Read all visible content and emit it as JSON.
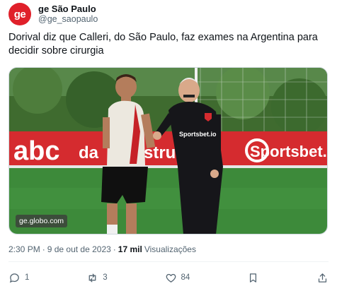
{
  "author": {
    "display_name": "ge São Paulo",
    "handle": "@ge_saopaulo",
    "avatar_text": "ge"
  },
  "tweet": {
    "text": "Dorival diz que Calleri, do São Paulo, faz exames na Argentina para decidir sobre cirurgia"
  },
  "media": {
    "banner_left": "abc",
    "banner_mid": "da",
    "banner_mid2": "strua",
    "banner_right": "Sportsbet.io",
    "shirt_text": "Sportsbet.io",
    "watermark": "ge.globo.com"
  },
  "meta": {
    "time": "2:30 PM",
    "sep1": "·",
    "date": "9 de out de 2023",
    "sep2": "·",
    "views_count": "17 mil",
    "views_label": "Visualizações"
  },
  "actions": {
    "reply_count": "1",
    "retweet_count": "3",
    "like_count": "84"
  },
  "colors": {
    "brand_red": "#e0202a",
    "text_primary": "#0f1419",
    "text_secondary": "#536471",
    "divider": "#eff3f4"
  }
}
